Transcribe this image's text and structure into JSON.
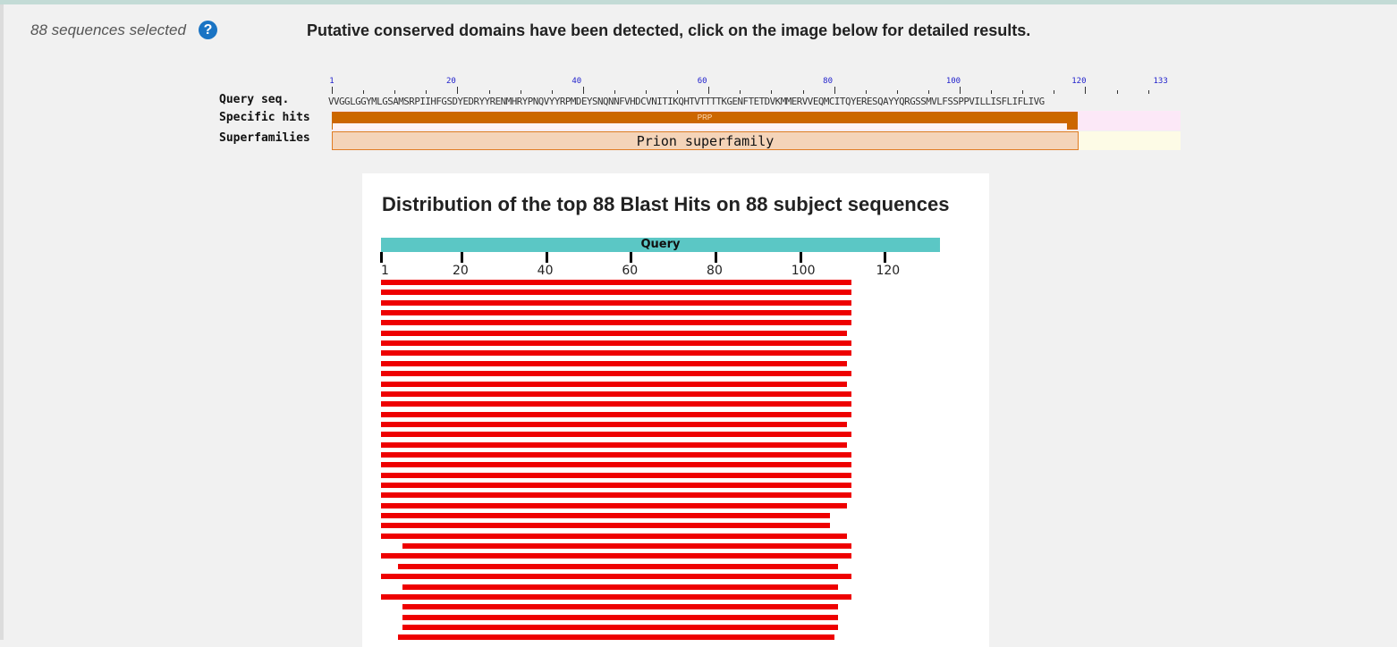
{
  "header": {
    "selected_text": "88 sequences selected",
    "help_glyph": "?",
    "message": "Putative conserved domains have been detected, click on the image below for detailed results."
  },
  "cdd": {
    "row_labels": {
      "query": "Query seq.",
      "specific": "Specific hits",
      "superfamilies": "Superfamilies"
    },
    "tick_numbers": [
      "1",
      "20",
      "40",
      "60",
      "80",
      "100",
      "120",
      "133"
    ],
    "query_sequence": "VVGGLGGYMLGSAMSRPIIHFGSDYEDRYYRENMHRYPNQVYYRPMDEYSNQNNFVHDCVNITIKQHTVTTTTKGENFTETDVKMMERVVEQMCITQYERESQAYYQRGSSMVLFSSPPVILLISFLIFLIVG",
    "specific_hit": "PRP",
    "superfamily": "Prion superfamily",
    "colors": {
      "specific": "#cc6600",
      "superfamily_fill": "#f4d4b9"
    }
  },
  "blast": {
    "title": "Distribution of the top 88 Blast Hits on 88 subject sequences",
    "query_label": "Query",
    "query_length": 133,
    "axis_labels": [
      "1",
      "20",
      "40",
      "60",
      "80",
      "100",
      "120"
    ],
    "colors": {
      "query": "#5bc7c5",
      "hit": "#ee0000"
    },
    "hits": [
      [
        1,
        112
      ],
      [
        1,
        112
      ],
      [
        1,
        112
      ],
      [
        1,
        112
      ],
      [
        1,
        112
      ],
      [
        1,
        111
      ],
      [
        1,
        112
      ],
      [
        1,
        112
      ],
      [
        1,
        111
      ],
      [
        1,
        112
      ],
      [
        1,
        111
      ],
      [
        1,
        112
      ],
      [
        1,
        112
      ],
      [
        1,
        112
      ],
      [
        1,
        111
      ],
      [
        1,
        112
      ],
      [
        1,
        111
      ],
      [
        1,
        112
      ],
      [
        1,
        112
      ],
      [
        1,
        112
      ],
      [
        1,
        112
      ],
      [
        1,
        112
      ],
      [
        1,
        111
      ],
      [
        1,
        107
      ],
      [
        1,
        107
      ],
      [
        1,
        111
      ],
      [
        6,
        112
      ],
      [
        1,
        112
      ],
      [
        5,
        109
      ],
      [
        1,
        112
      ],
      [
        6,
        109
      ],
      [
        1,
        112
      ],
      [
        6,
        109
      ],
      [
        6,
        109
      ],
      [
        6,
        109
      ],
      [
        5,
        108
      ]
    ]
  }
}
